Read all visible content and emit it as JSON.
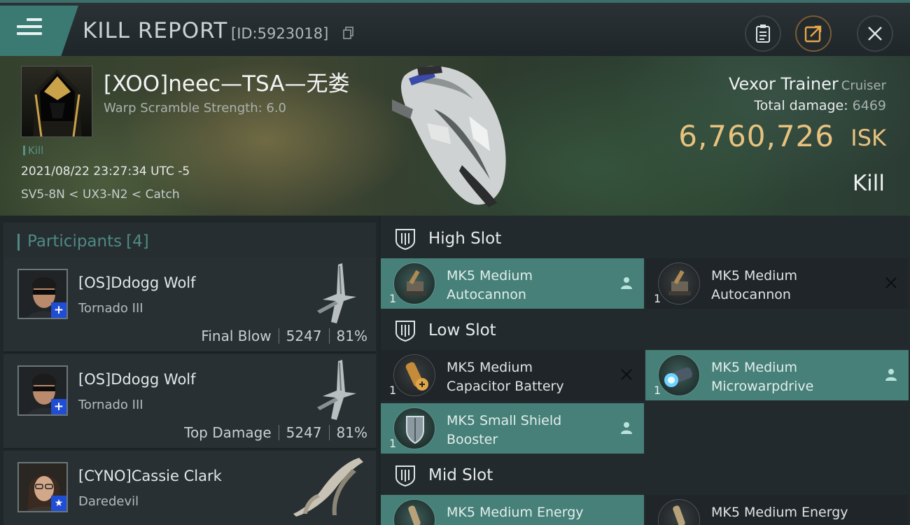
{
  "header": {
    "title": "KILL REPORT",
    "report_id": "[ID:5923018]",
    "buttons": [
      "clipboard-icon",
      "share-icon",
      "close-icon"
    ]
  },
  "victim": {
    "pilot": "[XOO]neec—TSA—无娄",
    "scramble": "Warp Scramble Strength: 6.0",
    "tag": "Kill",
    "timestamp": "2021/08/22 23:27:34 UTC -5",
    "location": "SV5-8N < UX3-N2 < Catch",
    "ship": "Vexor Trainer",
    "ship_class": "Cruiser",
    "total_damage_label": "Total damage:",
    "total_damage": "6469",
    "isk_value": "6,760,726",
    "isk_unit": "ISK",
    "result": "Kill"
  },
  "participants": {
    "label": "Participants",
    "count": "[4]",
    "items": [
      {
        "name": "[OS]Ddogg Wolf",
        "ship": "Tornado III",
        "role": "Final Blow",
        "damage": "5247",
        "percent": "81%",
        "badge": "+"
      },
      {
        "name": "[OS]Ddogg Wolf",
        "ship": "Tornado III",
        "role": "Top Damage",
        "damage": "5247",
        "percent": "81%",
        "badge": "+"
      },
      {
        "name": "[CYNO]Cassie Clark",
        "ship": "Daredevil",
        "badge": "★"
      }
    ]
  },
  "slots": {
    "high": {
      "label": "High Slot",
      "modules": [
        {
          "qty": "1",
          "line1": "MK5 Medium",
          "line2": "Autocannon",
          "state": "fitted"
        },
        {
          "qty": "1",
          "line1": "MK5 Medium",
          "line2": "Autocannon",
          "state": "destroyed"
        }
      ]
    },
    "low": {
      "label": "Low Slot",
      "modules": [
        {
          "qty": "1",
          "line1": "MK5 Medium",
          "line2": "Capacitor Battery",
          "state": "destroyed"
        },
        {
          "qty": "1",
          "line1": "MK5 Medium",
          "line2": "Microwarpdrive",
          "state": "fitted"
        },
        {
          "qty": "1",
          "line1": "MK5 Small Shield",
          "line2": "Booster",
          "state": "fitted"
        }
      ]
    },
    "mid": {
      "label": "Mid Slot",
      "modules": [
        {
          "line1": "MK5 Medium Energy"
        },
        {
          "line1": "MK5 Medium Energy"
        }
      ]
    }
  },
  "colors": {
    "accent": "#468078",
    "isk": "#e8c27e",
    "badge": "#1f4dd4"
  }
}
